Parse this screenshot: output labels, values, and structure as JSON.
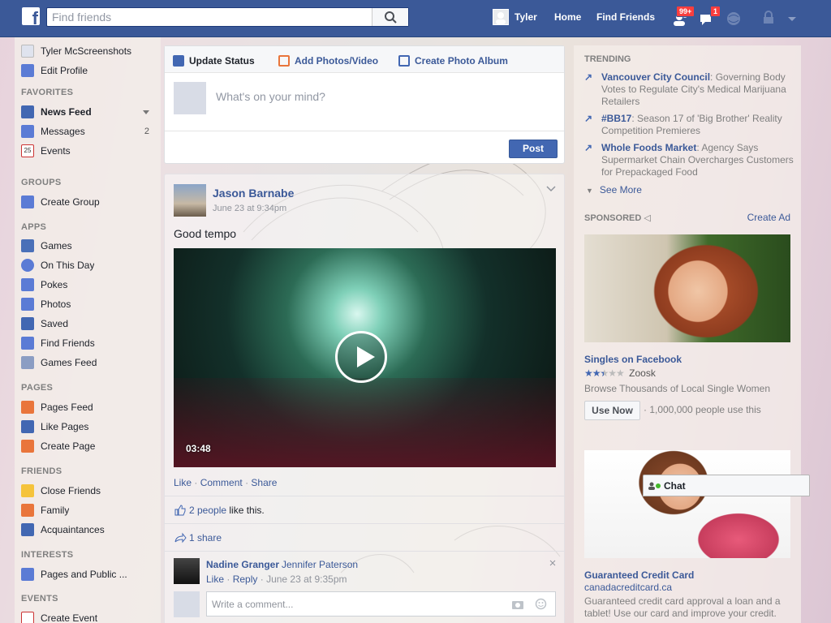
{
  "topbar": {
    "logo": "f",
    "search_placeholder": "Find friends",
    "user": "Tyler",
    "home": "Home",
    "find_friends": "Find Friends",
    "friend_requests_badge": "99+",
    "messages_badge": "1"
  },
  "leftnav": {
    "profile_name": "Tyler McScreenshots",
    "edit_profile": "Edit Profile",
    "favorites_header": "FAVORITES",
    "favorites": [
      {
        "label": "News Feed"
      },
      {
        "label": "Messages",
        "count": "2"
      },
      {
        "label": "Events",
        "icon_text": "25"
      }
    ],
    "groups_header": "GROUPS",
    "groups": [
      {
        "label": "Create Group"
      }
    ],
    "apps_header": "APPS",
    "apps": [
      {
        "label": "Games"
      },
      {
        "label": "On This Day"
      },
      {
        "label": "Pokes"
      },
      {
        "label": "Photos"
      },
      {
        "label": "Saved"
      },
      {
        "label": "Find Friends"
      },
      {
        "label": "Games Feed"
      }
    ],
    "pages_header": "PAGES",
    "pages": [
      {
        "label": "Pages Feed"
      },
      {
        "label": "Like Pages"
      },
      {
        "label": "Create Page"
      }
    ],
    "friends_header": "FRIENDS",
    "friends": [
      {
        "label": "Close Friends"
      },
      {
        "label": "Family"
      },
      {
        "label": "Acquaintances"
      }
    ],
    "interests_header": "INTERESTS",
    "interests": [
      {
        "label": "Pages and Public ..."
      }
    ],
    "events_header": "EVENTS",
    "events": [
      {
        "label": "Create Event"
      }
    ]
  },
  "composer": {
    "tab_status": "Update Status",
    "tab_photos": "Add Photos/Video",
    "tab_album": "Create Photo Album",
    "placeholder": "What's on your mind?",
    "post": "Post"
  },
  "story": {
    "author": "Jason Barnabe",
    "time": "June 23 at 9:34pm",
    "text": "Good tempo",
    "video_duration": "03:48",
    "like": "Like",
    "comment": "Comment",
    "share": "Share",
    "likes_link": "2 people",
    "likes_suffix": " like this.",
    "shares": "1 share",
    "comment_author": "Nadine Granger",
    "comment_text": "Jennifer Paterson",
    "comment_like": "Like",
    "comment_reply": "Reply",
    "comment_time": "June 23 at 9:35pm",
    "write_placeholder": "Write a comment..."
  },
  "rightcol": {
    "trending_header": "TRENDING",
    "trending": [
      {
        "topic": "Vancouver City Council",
        "text": ": Governing Body Votes to Regulate City's Medical Marijuana Retailers"
      },
      {
        "topic": "#BB17",
        "text": ": Season 17 of 'Big Brother' Reality Competition Premieres"
      },
      {
        "topic": "Whole Foods Market",
        "text": ": Agency Says Supermarket Chain Overcharges Customers for Prepackaged Food"
      }
    ],
    "see_more": "See More",
    "sponsored_header": "SPONSORED",
    "create_ad": "Create Ad",
    "ad1": {
      "title": "Singles on Facebook",
      "rating": 2.5,
      "rating_source": "Zoosk",
      "desc": "Browse Thousands of Local Single Women",
      "cta": "Use Now",
      "users": "· 1,000,000 people use this"
    },
    "ad2": {
      "title": "Guaranteed Credit Card",
      "url": "canadacreditcard.ca",
      "desc": "Guaranteed credit card approval a loan and a tablet! Use our card and improve your credit."
    }
  },
  "chat": {
    "label": "Chat"
  },
  "colors": {
    "brand": "#3b5998",
    "link": "#3b5998",
    "badge": "#fa3e3e",
    "button": "#4267b2"
  }
}
